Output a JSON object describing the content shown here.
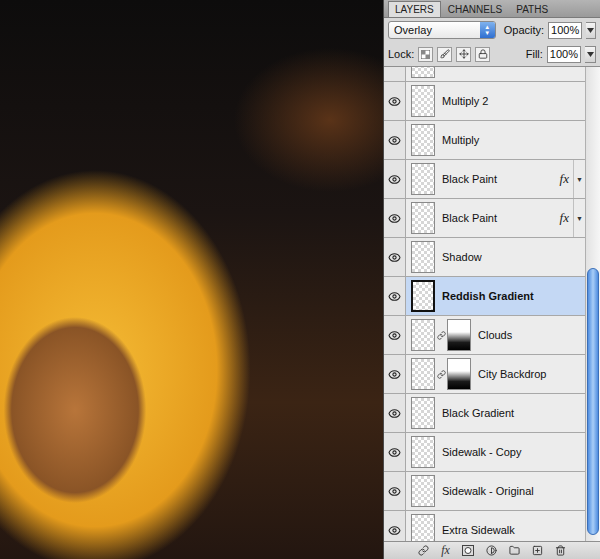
{
  "panel": {
    "tabs": [
      {
        "label": "LAYERS",
        "selected": true
      },
      {
        "label": "CHANNELS",
        "selected": false
      },
      {
        "label": "PATHS",
        "selected": false
      }
    ],
    "blend_mode": "Overlay",
    "opacity_label": "Opacity:",
    "opacity": "100%",
    "lock_label": "Lock:",
    "fill_label": "Fill:",
    "fill": "100%"
  },
  "layers": [
    {
      "name": "",
      "visible": true,
      "selected": false,
      "effects": "",
      "mask": false
    },
    {
      "name": "Multiply 2",
      "visible": true,
      "selected": false,
      "effects": "",
      "mask": false
    },
    {
      "name": "Multiply",
      "visible": true,
      "selected": false,
      "effects": "",
      "mask": false
    },
    {
      "name": "Black Paint",
      "visible": true,
      "selected": false,
      "effects": "fx",
      "mask": false
    },
    {
      "name": "Black Paint",
      "visible": true,
      "selected": false,
      "effects": "fx",
      "mask": false
    },
    {
      "name": "Shadow",
      "visible": true,
      "selected": false,
      "effects": "",
      "mask": false
    },
    {
      "name": "Reddish Gradient",
      "visible": true,
      "selected": true,
      "effects": "",
      "mask": false
    },
    {
      "name": "Clouds",
      "visible": true,
      "selected": false,
      "effects": "",
      "mask": true
    },
    {
      "name": "City Backdrop",
      "visible": true,
      "selected": false,
      "effects": "",
      "mask": true
    },
    {
      "name": "Black Gradient",
      "visible": true,
      "selected": false,
      "effects": "",
      "mask": false
    },
    {
      "name": "Sidewalk - Copy",
      "visible": true,
      "selected": false,
      "effects": "",
      "mask": false
    },
    {
      "name": "Sidewalk - Original",
      "visible": true,
      "selected": false,
      "effects": "",
      "mask": false
    },
    {
      "name": "Extra Sidewalk",
      "visible": true,
      "selected": false,
      "effects": "",
      "mask": false
    }
  ],
  "scrollbar": {
    "level": 0.57
  },
  "bottom_bar": {
    "effects_label": "fx"
  }
}
